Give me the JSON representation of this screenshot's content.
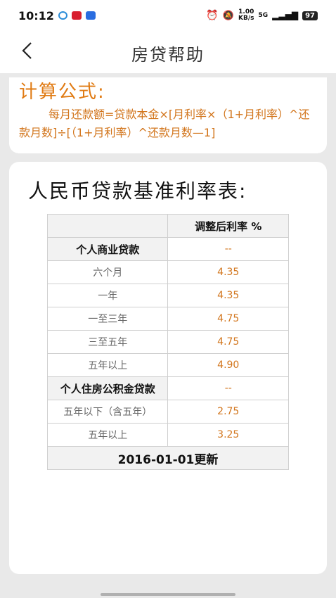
{
  "status_bar": {
    "time": "10:12",
    "network_speed": "1.00\nKB/s",
    "signal": "5G",
    "battery": "97"
  },
  "nav": {
    "back_symbol": "<",
    "title": "房贷帮助"
  },
  "formula": {
    "title": "计算公式:",
    "text": "每月还款额=贷款本金×[月利率×（1+月利率）^还款月数]÷[（1+月利率）^还款月数—1]"
  },
  "rates": {
    "title": "人民币贷款基准利率表:",
    "header_right": "调整后利率   %",
    "commercial_label": "个人商业贷款",
    "commercial_value": "--",
    "commercial_rows": [
      {
        "term": "六个月",
        "rate": "4.35"
      },
      {
        "term": "一年",
        "rate": "4.35"
      },
      {
        "term": "一至三年",
        "rate": "4.75"
      },
      {
        "term": "三至五年",
        "rate": "4.75"
      },
      {
        "term": "五年以上",
        "rate": "4.90"
      }
    ],
    "fund_label": "个人住房公积金贷款",
    "fund_value": "--",
    "fund_rows": [
      {
        "term": "五年以下（含五年）",
        "rate": "2.75"
      },
      {
        "term": "五年以上",
        "rate": "3.25"
      }
    ],
    "footer": "2016-01-01更新"
  },
  "colors": {
    "accent": "#e07a12",
    "value": "#d2751c",
    "background": "#e9e9e9"
  }
}
